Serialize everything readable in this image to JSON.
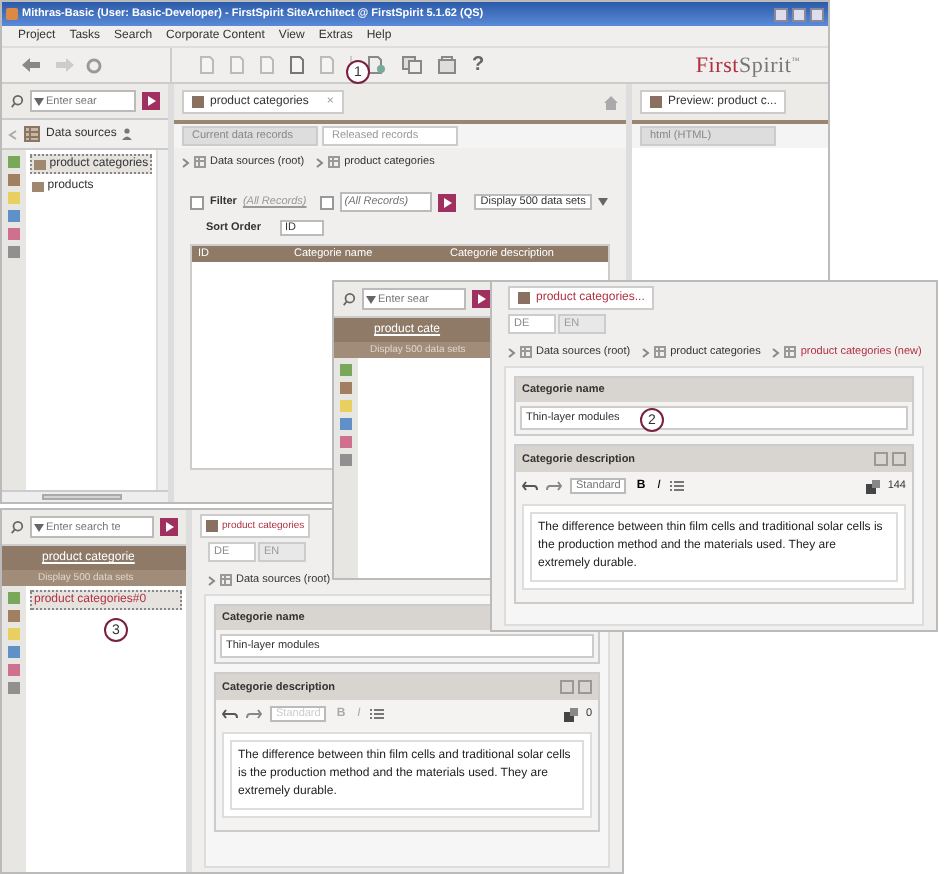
{
  "main_window": {
    "title": "Mithras-Basic (User: Basic-Developer) - FirstSpirit SiteArchitect @ FirstSpirit 5.1.62 (QS)",
    "menu": [
      "Project",
      "Tasks",
      "Search",
      "Corporate Content",
      "View",
      "Extras",
      "Help"
    ],
    "help_glyph": "?",
    "logo": [
      "First",
      "Spirit",
      "™"
    ],
    "navigation": {
      "search_placeholder": "Enter sear",
      "header": "Data sources",
      "tree": [
        {
          "label": "product categories",
          "selected": true
        },
        {
          "label": "products",
          "selected": false
        }
      ]
    },
    "editor": {
      "tab": "product categories",
      "tab_close": "×",
      "subtabs": [
        {
          "label": "Current data records",
          "selected": true
        },
        {
          "label": "Released records",
          "selected": false
        }
      ],
      "breadcrumb": [
        "Data sources (root)",
        "product categories"
      ],
      "filter": {
        "label": "Filter",
        "checked": false,
        "value": "(All Records)"
      },
      "filter2": {
        "checked": false,
        "placeholder": "(All Records)"
      },
      "display": "Display 500 data sets",
      "sort_label": "Sort Order",
      "sort_field": "ID",
      "columns": [
        "ID",
        "Categorie name",
        "Categorie description"
      ]
    },
    "preview": {
      "tab": "Preview: product c...",
      "subtab": "html (HTML)"
    }
  },
  "narrow_window": {
    "search_placeholder": "Enter sear",
    "header": "product cate",
    "display": "Display 500 data sets"
  },
  "right_editor": {
    "tab": "product categories...",
    "languages": [
      {
        "label": "DE",
        "selected": true
      },
      {
        "label": "EN",
        "selected": false
      }
    ],
    "breadcrumb": [
      "Data sources (root)",
      "product categories",
      "product categories (new)"
    ],
    "name_label": "Categorie name",
    "name_value": "Thin-layer modules",
    "description_label": "Categorie description",
    "style": "Standard",
    "format_buttons": [
      "B",
      "I"
    ],
    "count": "144",
    "disabled": false,
    "description": "The difference between thin film cells and traditional solar cells is the production method and the materials used. They are extremely durable."
  },
  "lower_window": {
    "search_placeholder": "Enter search te",
    "header": "product categorie",
    "display": "Display 500 data sets",
    "tree": [
      {
        "label": "product categories#0",
        "selected": true
      }
    ],
    "editor": {
      "tab": "product categories",
      "languages": [
        {
          "label": "DE",
          "selected": true
        },
        {
          "label": "EN",
          "selected": false
        }
      ],
      "breadcrumb": [
        "Data sources (root)"
      ],
      "name_label": "Categorie name",
      "name_value": "Thin-layer modules",
      "description_label": "Categorie description",
      "style": "Standard",
      "format_buttons": [
        "B",
        "I"
      ],
      "count": "0",
      "disabled": true,
      "description": "The difference between thin film cells and traditional solar cells is the production method and the materials used. They are extremely durable."
    }
  },
  "callouts": [
    "1",
    "2",
    "3"
  ]
}
